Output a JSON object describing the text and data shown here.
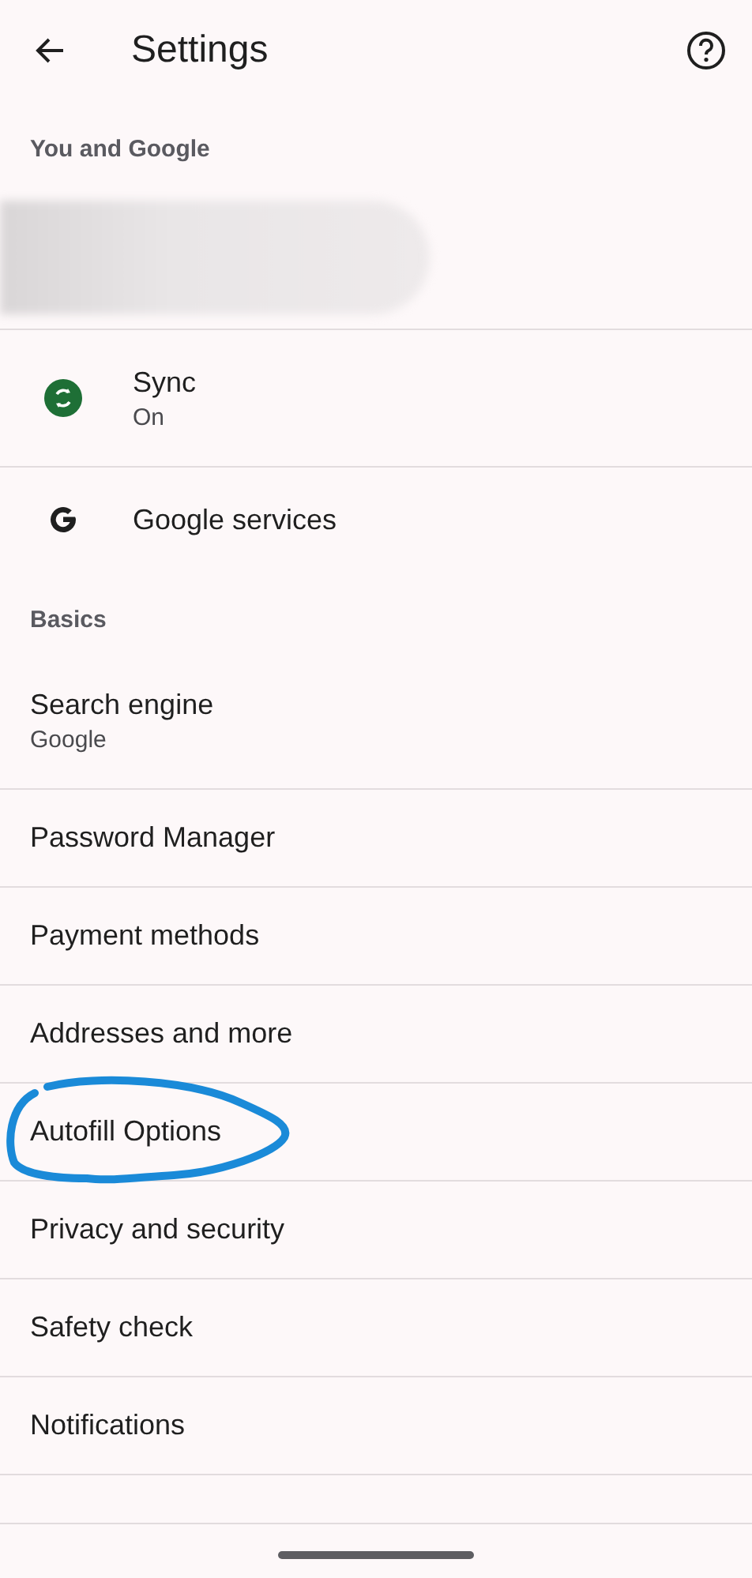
{
  "app_bar": {
    "title": "Settings"
  },
  "sections": [
    {
      "heading": "You and Google",
      "items": [
        {
          "kind": "account"
        },
        {
          "kind": "sync",
          "title": "Sync",
          "subtitle": "On"
        },
        {
          "kind": "google",
          "title": "Google services"
        }
      ]
    },
    {
      "heading": "Basics",
      "items": [
        {
          "kind": "plain",
          "title": "Search engine",
          "subtitle": "Google"
        },
        {
          "kind": "plain",
          "title": "Password Manager"
        },
        {
          "kind": "plain",
          "title": "Payment methods"
        },
        {
          "kind": "plain",
          "title": "Addresses and more"
        },
        {
          "kind": "plain",
          "title": "Autofill Options",
          "highlighted": true
        },
        {
          "kind": "plain",
          "title": "Privacy and security"
        },
        {
          "kind": "plain",
          "title": "Safety check"
        },
        {
          "kind": "plain",
          "title": "Notifications"
        },
        {
          "kind": "cut"
        }
      ]
    }
  ]
}
